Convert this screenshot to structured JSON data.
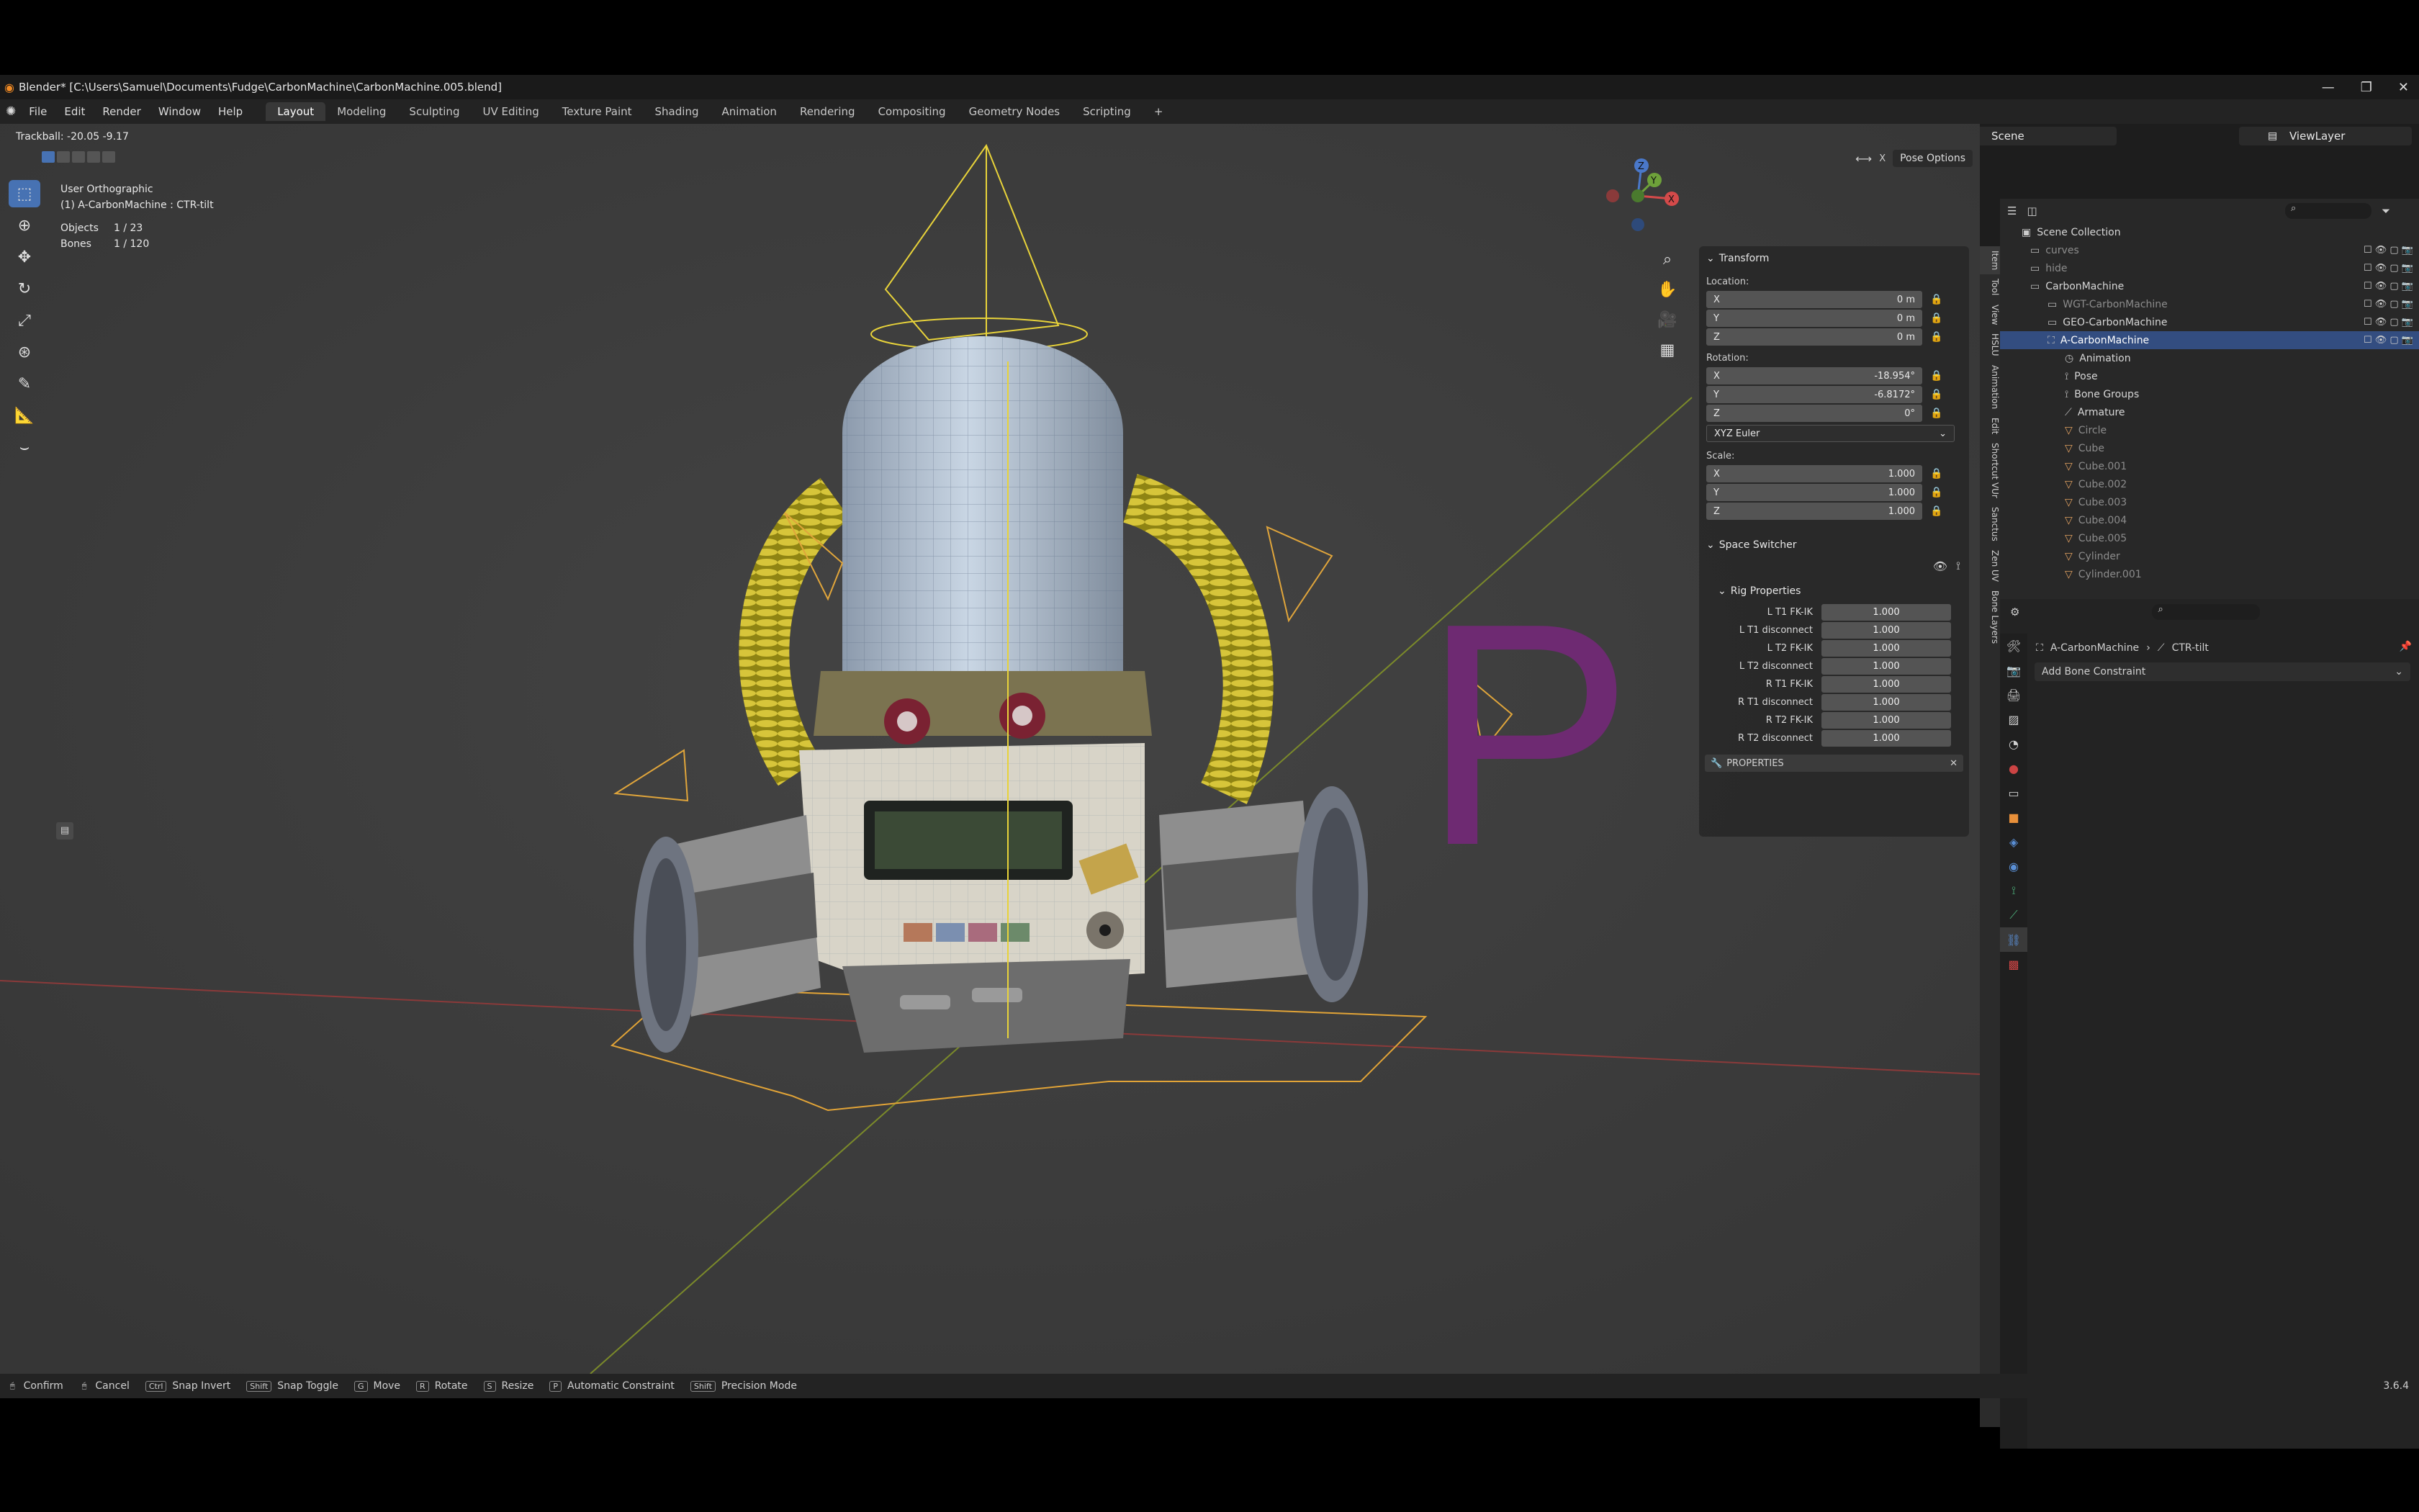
{
  "titlebar": {
    "title": "Blender* [C:\\Users\\Samuel\\Documents\\Fudge\\CarbonMachine\\CarbonMachine.005.blend]"
  },
  "menu": [
    "File",
    "Edit",
    "Render",
    "Window",
    "Help"
  ],
  "workspaces": [
    "Layout",
    "Modeling",
    "Sculpting",
    "UV Editing",
    "Texture Paint",
    "Shading",
    "Animation",
    "Rendering",
    "Compositing",
    "Geometry Nodes",
    "Scripting"
  ],
  "active_workspace": "Layout",
  "scene": "Scene",
  "viewlayer": "ViewLayer",
  "viewport": {
    "trackball": "Trackball: -20.05 -9.17",
    "view_name": "User Orthographic",
    "active_object": "(1) A-CarbonMachine : CTR-tilt",
    "objects_label": "Objects",
    "objects_value": "1 / 23",
    "bones_label": "Bones",
    "bones_value": "1 / 120",
    "pose_options": "Pose Options",
    "big_letter": "P",
    "gizmo": {
      "x": "X",
      "y": "Y",
      "z": "Z"
    }
  },
  "npanel": {
    "transform_title": "Transform",
    "location_label": "Location:",
    "location": [
      {
        "axis": "X",
        "value": "0 m"
      },
      {
        "axis": "Y",
        "value": "0 m"
      },
      {
        "axis": "Z",
        "value": "0 m"
      }
    ],
    "rotation_label": "Rotation:",
    "rotation": [
      {
        "axis": "X",
        "value": "-18.954°"
      },
      {
        "axis": "Y",
        "value": "-6.8172°"
      },
      {
        "axis": "Z",
        "value": "0°"
      }
    ],
    "rotation_mode": "XYZ Euler",
    "scale_label": "Scale:",
    "scale": [
      {
        "axis": "X",
        "value": "1.000"
      },
      {
        "axis": "Y",
        "value": "1.000"
      },
      {
        "axis": "Z",
        "value": "1.000"
      }
    ],
    "space_switcher_title": "Space Switcher",
    "rig_properties_title": "Rig Properties",
    "rig_properties": [
      {
        "label": "L T1 FK-IK",
        "value": "1.000"
      },
      {
        "label": "L T1 disconnect",
        "value": "1.000"
      },
      {
        "label": "L T2 FK-IK",
        "value": "1.000"
      },
      {
        "label": "L T2 disconnect",
        "value": "1.000"
      },
      {
        "label": "R T1 FK-IK",
        "value": "1.000"
      },
      {
        "label": "R T1 disconnect",
        "value": "1.000"
      },
      {
        "label": "R T2 FK-IK",
        "value": "1.000"
      },
      {
        "label": "R T2 disconnect",
        "value": "1.000"
      }
    ],
    "properties_title": "PROPERTIES"
  },
  "side_tabs": [
    "Item",
    "Tool",
    "View",
    "HSLU",
    "Animation",
    "Edit",
    "Shortcut VUr",
    "Sanctus",
    "Zen UV",
    "Bone Layers"
  ],
  "outliner": {
    "root": "Scene Collection",
    "rows": [
      {
        "name": "curves",
        "indent": 1,
        "dim": true
      },
      {
        "name": "hide",
        "indent": 1,
        "dim": true
      },
      {
        "name": "CarbonMachine",
        "indent": 1,
        "dim": false
      },
      {
        "name": "WGT-CarbonMachine",
        "indent": 2,
        "dim": true
      },
      {
        "name": "GEO-CarbonMachine",
        "indent": 2,
        "dim": false
      },
      {
        "name": "A-CarbonMachine",
        "indent": 2,
        "dim": false,
        "selected": true
      },
      {
        "name": "Animation",
        "indent": 3,
        "dim": false
      },
      {
        "name": "Pose",
        "indent": 3,
        "dim": false
      },
      {
        "name": "Bone Groups",
        "indent": 3,
        "dim": false
      },
      {
        "name": "Armature",
        "indent": 3,
        "dim": false
      },
      {
        "name": "Circle",
        "indent": 3,
        "dim": true
      },
      {
        "name": "Cube",
        "indent": 3,
        "dim": true
      },
      {
        "name": "Cube.001",
        "indent": 3,
        "dim": true
      },
      {
        "name": "Cube.002",
        "indent": 3,
        "dim": true
      },
      {
        "name": "Cube.003",
        "indent": 3,
        "dim": true
      },
      {
        "name": "Cube.004",
        "indent": 3,
        "dim": true
      },
      {
        "name": "Cube.005",
        "indent": 3,
        "dim": true
      },
      {
        "name": "Cylinder",
        "indent": 3,
        "dim": true
      },
      {
        "name": "Cylinder.001",
        "indent": 3,
        "dim": true
      }
    ]
  },
  "properties": {
    "breadcrumb_object": "A-CarbonMachine",
    "breadcrumb_bone": "CTR-tilt",
    "add_constraint": "Add Bone Constraint"
  },
  "statusbar": {
    "items": [
      "Confirm",
      "Cancel",
      "Snap Invert",
      "Snap Toggle",
      "Move",
      "Rotate",
      "Resize",
      "Automatic Constraint",
      "Precision Mode"
    ],
    "keys": [
      "",
      "",
      "Ctrl",
      "Shift",
      "G",
      "R",
      "S",
      "P",
      "Shift"
    ],
    "version": "3.6.4"
  },
  "colors": {
    "accent": "#4772b3",
    "selected_row": "#334d80",
    "rig_yellow": "#e8d33a",
    "letter_purple": "#6e2a72"
  }
}
